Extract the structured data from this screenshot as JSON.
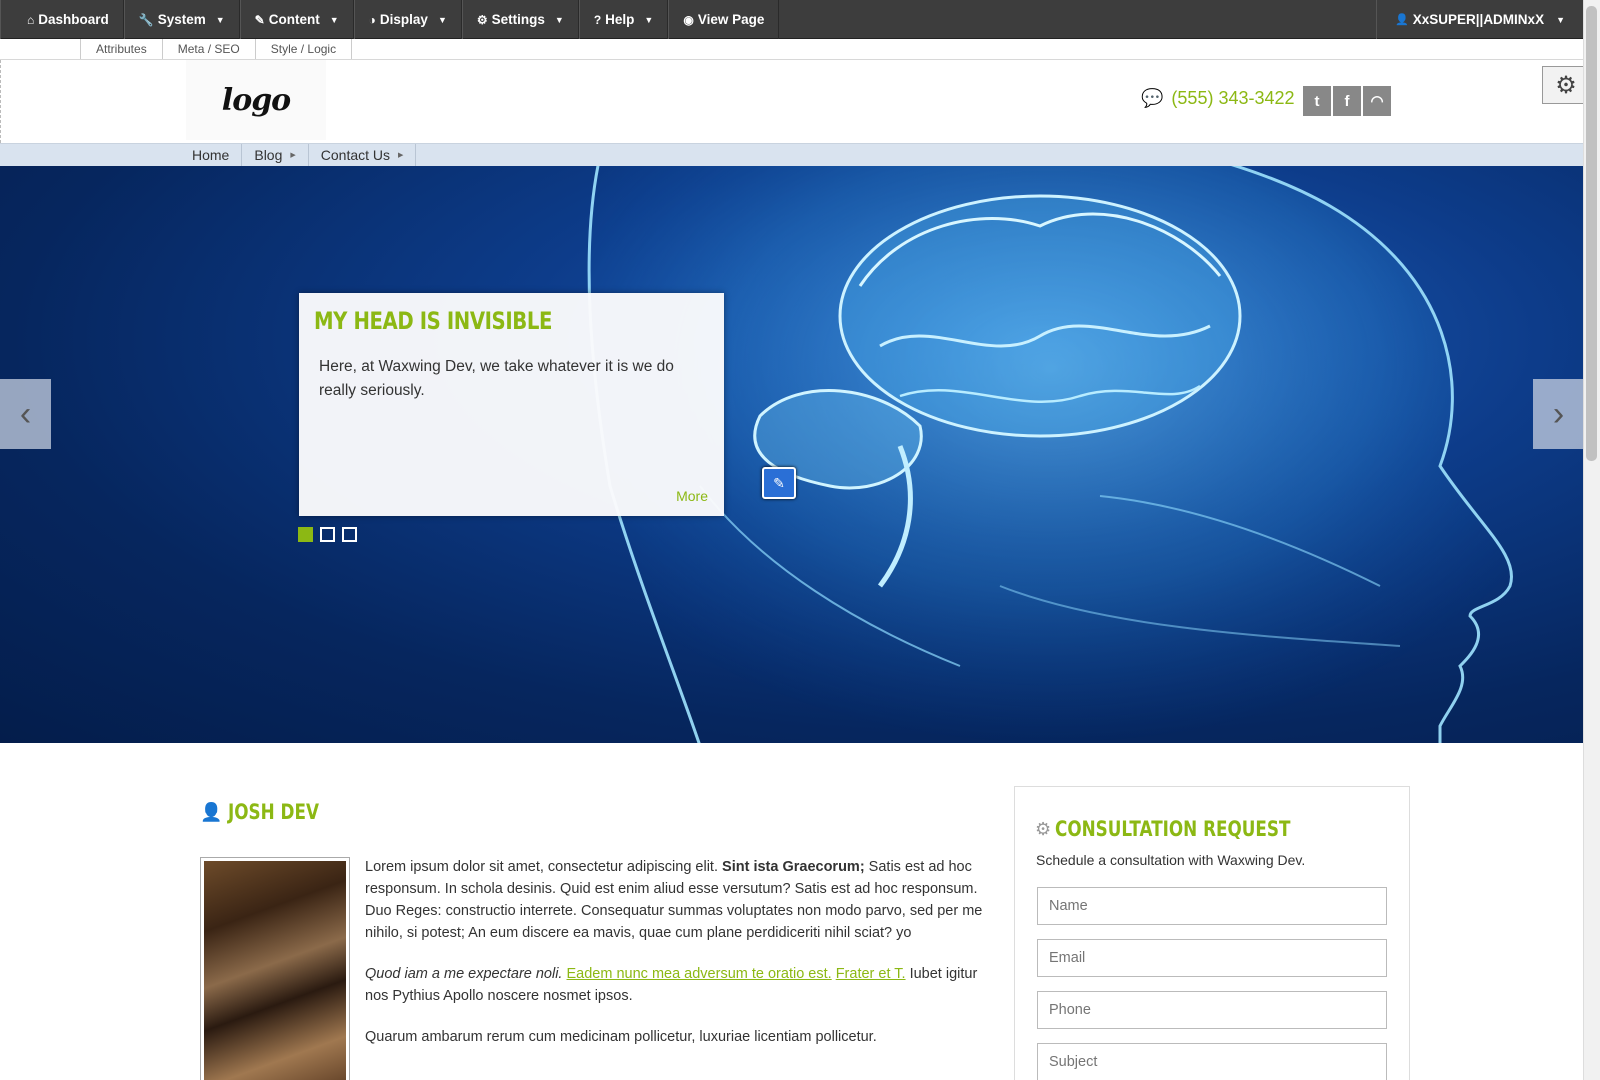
{
  "admin_bar": {
    "items": [
      {
        "icon": "home-icon",
        "glyph": "⌂",
        "label": "Dashboard",
        "caret": false
      },
      {
        "icon": "wrench-icon",
        "glyph": "🔧",
        "label": "System",
        "caret": true
      },
      {
        "icon": "edit-icon",
        "glyph": "✎",
        "label": "Content",
        "caret": true
      },
      {
        "icon": "contrast-icon",
        "glyph": "◑",
        "label": "Display",
        "caret": true
      },
      {
        "icon": "gear-icon",
        "glyph": "⚙",
        "label": "Settings",
        "caret": true
      },
      {
        "icon": "question-icon",
        "glyph": "?",
        "label": "Help",
        "caret": true
      },
      {
        "icon": "eye-icon",
        "glyph": "◉",
        "label": "View Page",
        "caret": false
      }
    ],
    "user": {
      "icon": "user-icon",
      "glyph": "👤",
      "label": "XxSUPER||ADMINxX"
    }
  },
  "sub_tabs": [
    "Attributes",
    "Meta / SEO",
    "Style / Logic"
  ],
  "header": {
    "logo_text": "logo",
    "phone": "(555) 343-3422",
    "social": [
      {
        "icon": "twitter-icon",
        "glyph": "t"
      },
      {
        "icon": "facebook-icon",
        "glyph": "f"
      },
      {
        "icon": "rss-icon",
        "glyph": "◠"
      }
    ]
  },
  "nav": [
    {
      "label": "Home",
      "arrow": false
    },
    {
      "label": "Blog",
      "arrow": true
    },
    {
      "label": "Contact Us",
      "arrow": true
    }
  ],
  "slider": {
    "title": "MY HEAD IS INVISIBLE",
    "text": "Here, at Waxwing Dev, we take whatever it is we do really seriously.",
    "more": "More",
    "dots": 3,
    "active_dot": 0,
    "prev": "‹",
    "next": "›"
  },
  "main": {
    "title": "JOSH DEV",
    "p1_plain": "Lorem ipsum dolor sit amet, consectetur adipiscing elit. ",
    "p1_bold": "Sint ista Graecorum;",
    "p1_rest": " Satis est ad hoc responsum. In schola desinis. Quid est enim aliud esse versutum? Satis est ad hoc responsum. Duo Reges: constructio interrete. Consequatur summas voluptates non modo parvo, sed per me nihilo, si potest; An eum discere ea mavis, quae cum plane perdidiceriti nihil sciat? yo",
    "p2_italic": "Quod iam a me expectare noli.",
    "p2_link1": "Eadem nunc mea adversum te oratio est.",
    "p2_link2": "Frater et T.",
    "p2_rest": " Iubet igitur nos Pythius Apollo noscere nosmet ipsos.",
    "p3": "Quarum ambarum rerum cum medicinam pollicetur, luxuriae licentiam pollicetur."
  },
  "sidebar": {
    "title": "CONSULTATION REQUEST",
    "subtitle": "Schedule a consultation with Waxwing Dev.",
    "fields": [
      "Name",
      "Email",
      "Phone",
      "Subject"
    ]
  },
  "colors": {
    "accent": "#8cb814",
    "admin_bar": "#3d3d3d",
    "nav_bar": "#d9e3ef",
    "hero": "#0d3c8a"
  }
}
